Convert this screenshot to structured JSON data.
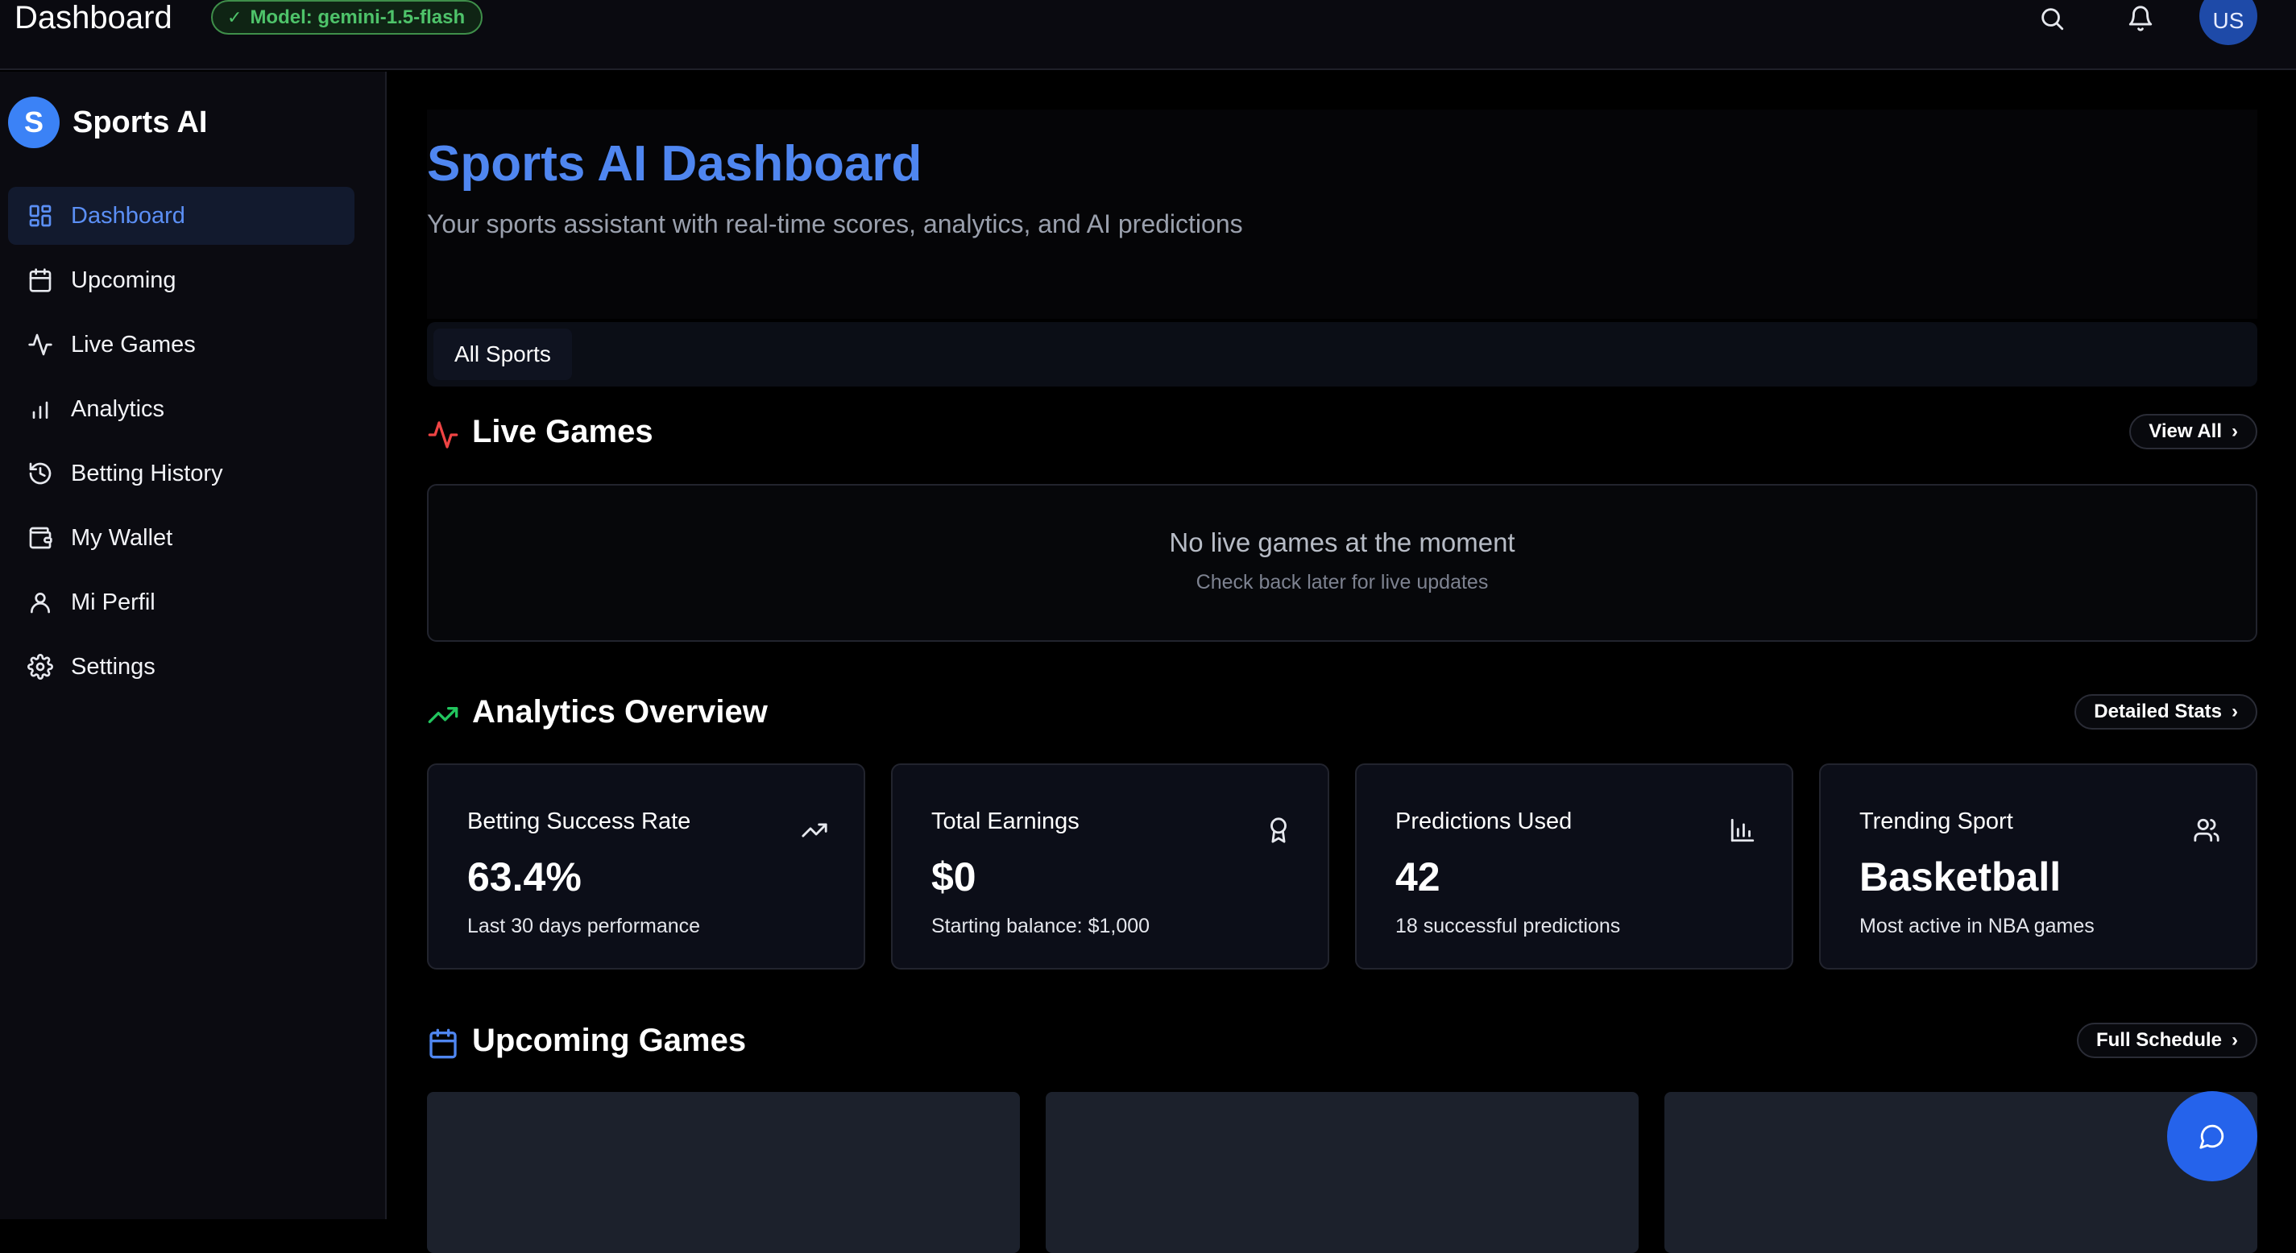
{
  "topbar": {
    "title": "Dashboard",
    "model_badge": "Model: gemini-1.5-flash",
    "avatar_initials": "US"
  },
  "sidebar": {
    "brand_initial": "S",
    "brand_name": "Sports AI",
    "items": [
      {
        "label": "Dashboard",
        "icon": "grid-icon",
        "active": true
      },
      {
        "label": "Upcoming",
        "icon": "calendar-icon",
        "active": false
      },
      {
        "label": "Live Games",
        "icon": "activity-icon",
        "active": false
      },
      {
        "label": "Analytics",
        "icon": "bar-chart-icon",
        "active": false
      },
      {
        "label": "Betting History",
        "icon": "history-icon",
        "active": false
      },
      {
        "label": "My Wallet",
        "icon": "wallet-icon",
        "active": false
      },
      {
        "label": "Mi Perfil",
        "icon": "user-icon",
        "active": false
      },
      {
        "label": "Settings",
        "icon": "gear-icon",
        "active": false
      }
    ]
  },
  "hero": {
    "title": "Sports AI Dashboard",
    "subtitle": "Your sports assistant with real-time scores, analytics, and AI predictions"
  },
  "filters": {
    "selected": "All Sports"
  },
  "live_games": {
    "title": "Live Games",
    "button": "View All",
    "empty_title": "No live games at the moment",
    "empty_subtitle": "Check back later for live updates"
  },
  "analytics": {
    "title": "Analytics Overview",
    "button": "Detailed Stats",
    "cards": [
      {
        "label": "Betting Success Rate",
        "value": "63.4%",
        "note": "Last 30 days performance",
        "icon": "trending-up-icon"
      },
      {
        "label": "Total Earnings",
        "value": "$0",
        "note": "Starting balance: $1,000",
        "icon": "award-icon"
      },
      {
        "label": "Predictions Used",
        "value": "42",
        "note": "18 successful predictions",
        "icon": "bar-chart-icon"
      },
      {
        "label": "Trending Sport",
        "value": "Basketball",
        "note": "Most active in NBA games",
        "icon": "users-icon"
      }
    ]
  },
  "upcoming": {
    "title": "Upcoming Games",
    "button": "Full Schedule"
  },
  "colors": {
    "accent": "#4f86f0",
    "badge_green": "#4ec36a",
    "live_red": "#ef4444",
    "analytics_green": "#22c55e",
    "fab": "#2563eb"
  }
}
